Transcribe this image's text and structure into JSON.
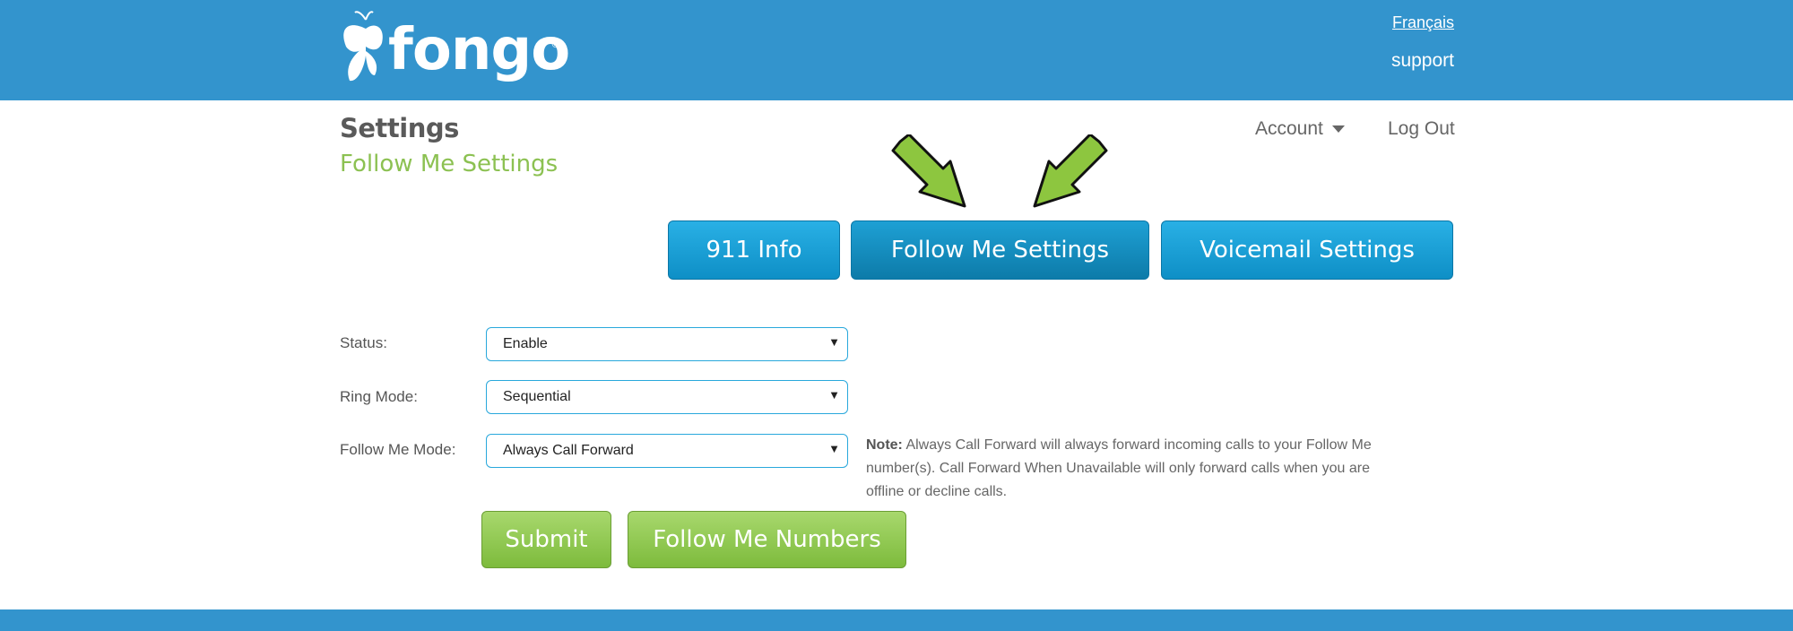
{
  "header": {
    "logo_text": "fongo",
    "logo_reg": "®",
    "lang_link": "Français",
    "support_link": "support"
  },
  "page": {
    "title": "Settings",
    "subtitle": "Follow Me Settings"
  },
  "nav": {
    "account": "Account",
    "logout": "Log Out"
  },
  "tabs": [
    {
      "label": "911 Info",
      "active": false
    },
    {
      "label": "Follow Me Settings",
      "active": true
    },
    {
      "label": "Voicemail Settings",
      "active": false
    }
  ],
  "form": {
    "status": {
      "label": "Status:",
      "value": "Enable"
    },
    "ring_mode": {
      "label": "Ring Mode:",
      "value": "Sequential"
    },
    "follow_me_mode": {
      "label": "Follow Me Mode:",
      "value": "Always Call Forward"
    },
    "dropdown_glyph": "▼"
  },
  "note": {
    "prefix": "Note:",
    "text": " Always Call Forward will always forward incoming calls to your Follow Me number(s). Call Forward When Unavailable will only forward calls when you are offline or decline calls."
  },
  "buttons": {
    "submit": "Submit",
    "follow_me_numbers": "Follow Me Numbers"
  },
  "colors": {
    "header_blue": "#3394cd",
    "tab_blue": "#1aa0d8",
    "accent_green": "#8cc152",
    "arrow_green": "#8dc63f"
  }
}
